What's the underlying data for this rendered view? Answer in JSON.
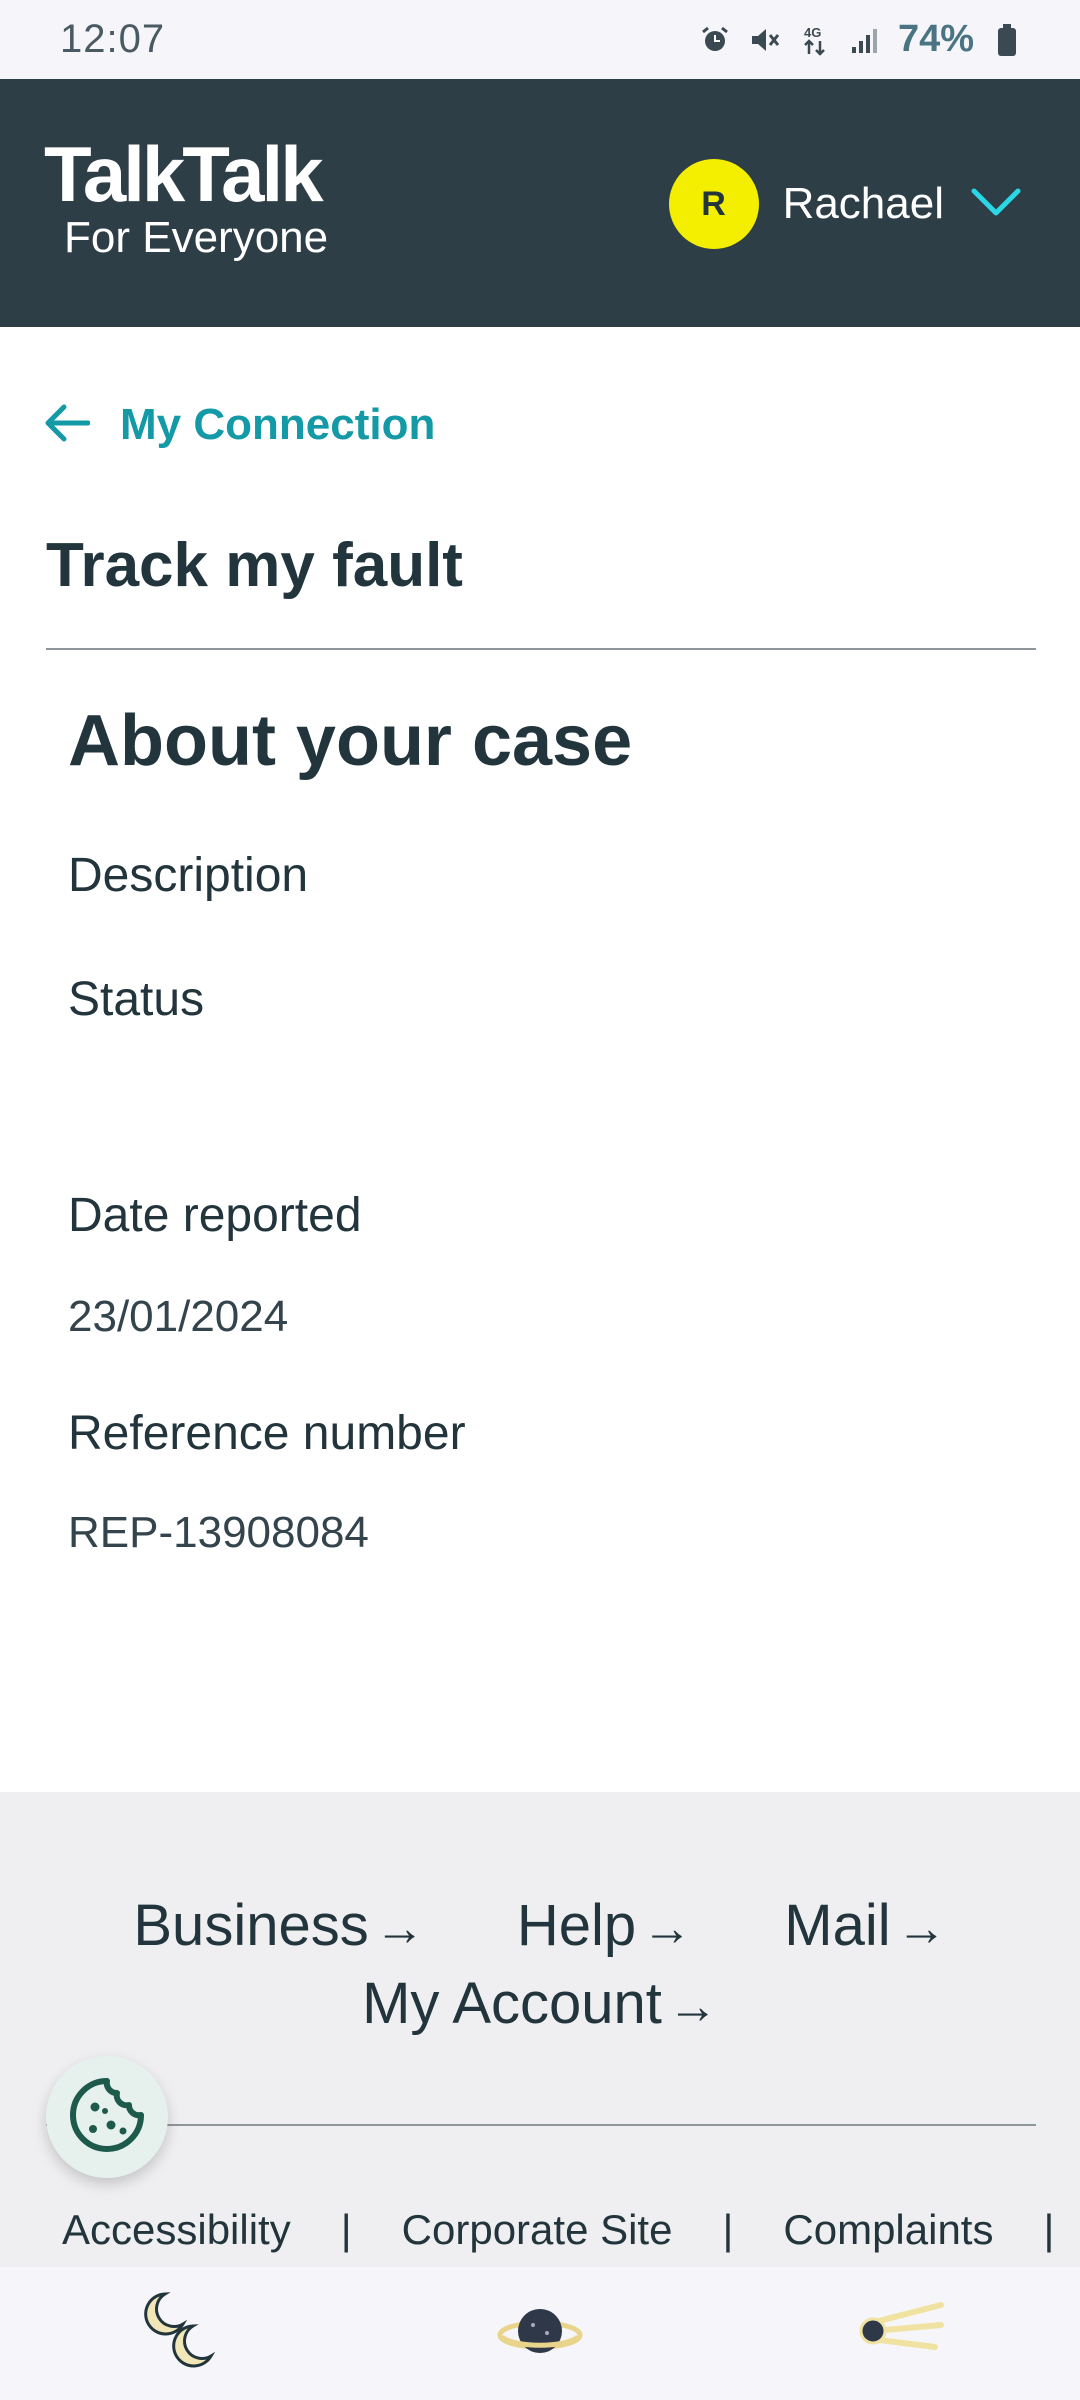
{
  "status_bar": {
    "time": "12:07",
    "battery_percent": "74%",
    "icons": [
      "alarm-icon",
      "mute-icon",
      "4g-data-icon",
      "signal-icon",
      "battery-icon"
    ]
  },
  "header": {
    "brand": "TalkTalk",
    "tagline": "For Everyone",
    "user": {
      "initial": "R",
      "name": "Rachael"
    },
    "colors": {
      "background": "#2e3e46",
      "avatar": "#f4ef00",
      "chevron": "#2bd6e6"
    }
  },
  "breadcrumb": {
    "back_label": "My Connection"
  },
  "page": {
    "title": "Track my fault"
  },
  "case": {
    "heading": "About your case",
    "description_label": "Description",
    "status_label": "Status",
    "date_label": "Date reported",
    "date_value": "23/01/2024",
    "reference_label": "Reference number",
    "reference_value": "REP-13908084"
  },
  "footer": {
    "links": [
      {
        "label": "Business"
      },
      {
        "label": "Help"
      },
      {
        "label": "Mail"
      },
      {
        "label": "My Account"
      }
    ],
    "legal": [
      "Accessibility",
      "Corporate Site",
      "Complaints"
    ]
  },
  "colors": {
    "accent": "#139aa6",
    "text": "#22343c",
    "footer_bg": "#efeff1"
  }
}
